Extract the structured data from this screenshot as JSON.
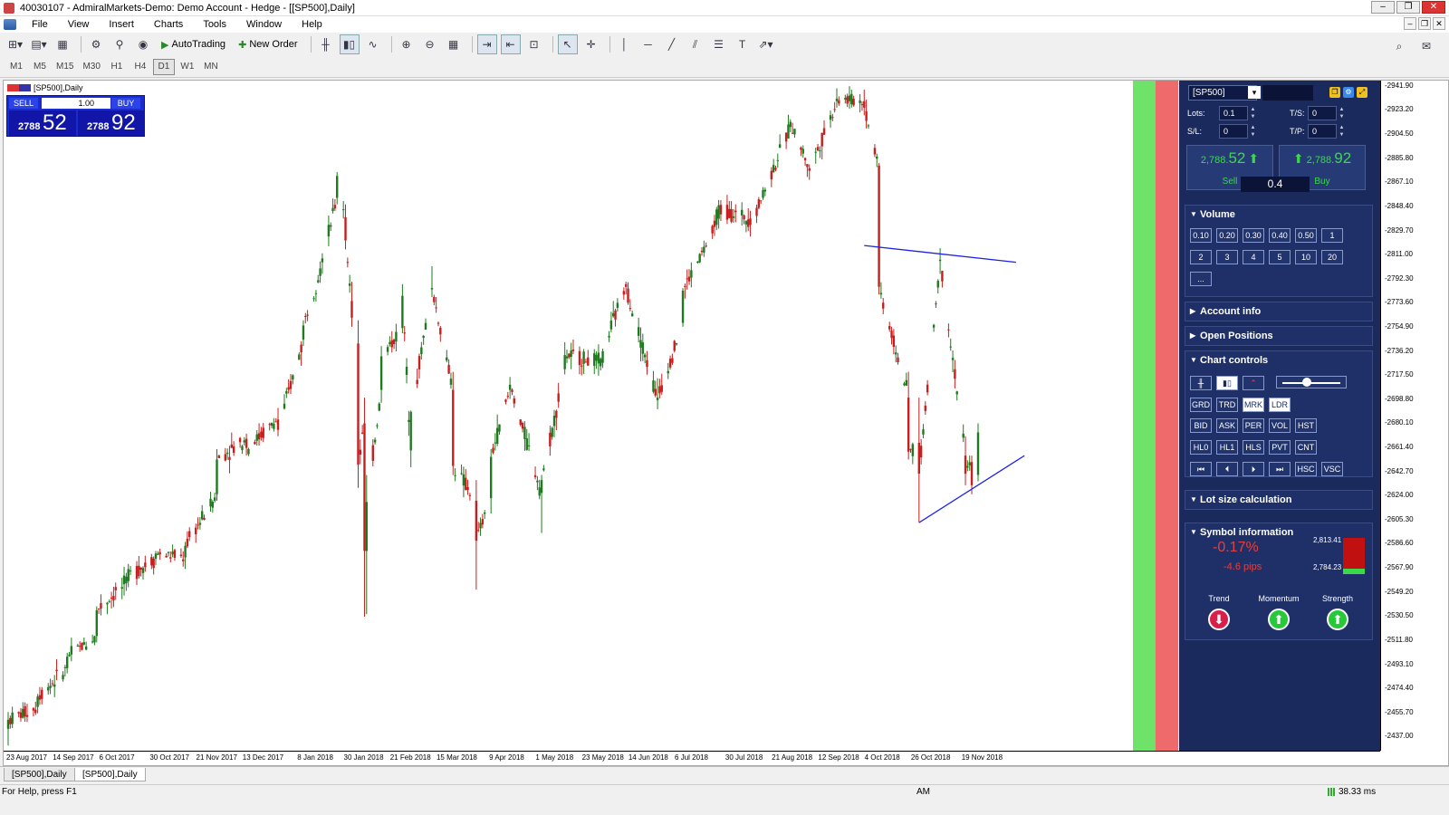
{
  "window": {
    "title": "40030107 - AdmiralMarkets-Demo: Demo Account - Hedge - [[SP500],Daily]",
    "buttons": [
      "–",
      "❐",
      "✕"
    ]
  },
  "menu": [
    "File",
    "View",
    "Insert",
    "Charts",
    "Tools",
    "Window",
    "Help"
  ],
  "toolbar": {
    "autotrading": "AutoTrading",
    "neworder": "New Order"
  },
  "timeframes": [
    "M1",
    "M5",
    "M15",
    "M30",
    "H1",
    "H4",
    "D1",
    "W1",
    "MN"
  ],
  "active_timeframe": "D1",
  "chart": {
    "title": "[SP500],Daily",
    "oneclick": {
      "sell_label": "SELL",
      "buy_label": "BUY",
      "lot": "1.00",
      "sell_small": "2788",
      "sell_big": "52",
      "buy_small": "2788",
      "buy_big": "92"
    },
    "x_ticks": [
      "23 Aug 2017",
      "14 Sep 2017",
      "6 Oct 2017",
      "30 Oct 2017",
      "21 Nov 2017",
      "13 Dec 2017",
      "8 Jan 2018",
      "30 Jan 2018",
      "21 Feb 2018",
      "15 Mar 2018",
      "9 Apr 2018",
      "1 May 2018",
      "23 May 2018",
      "14 Jun 2018",
      "6 Jul 2018",
      "30 Jul 2018",
      "21 Aug 2018",
      "12 Sep 2018",
      "4 Oct 2018",
      "26 Oct 2018",
      "19 Nov 2018"
    ],
    "y_ticks": [
      "2941.90",
      "2923.20",
      "2904.50",
      "2885.80",
      "2867.10",
      "2848.40",
      "2829.70",
      "2811.00",
      "2792.30",
      "2773.60",
      "2754.90",
      "2736.20",
      "2717.50",
      "2698.80",
      "2680.10",
      "2661.40",
      "2642.70",
      "2624.00",
      "2605.30",
      "2586.60",
      "2567.90",
      "2549.20",
      "2530.50",
      "2511.80",
      "2493.10",
      "2474.40",
      "2455.70",
      "2437.00"
    ],
    "colors": {
      "up": "#1f7a1f",
      "down": "#c81e1e",
      "trendline": "#1c22e6"
    }
  },
  "chart_data": {
    "type": "candlestick",
    "ylim": [
      2426.0,
      2946.0
    ],
    "grid": false,
    "x_start": "23 Aug 2017",
    "x_end": "26 Nov 2018",
    "anchors": [
      [
        "23 Aug 2017",
        2443,
        2456,
        2430,
        2450
      ],
      [
        "6 Sep 2017",
        2460,
        2470,
        2455,
        2468
      ],
      [
        "20 Sep 2017",
        2490,
        2502,
        2486,
        2499
      ],
      [
        "4 Oct 2017",
        2515,
        2538,
        2510,
        2535
      ],
      [
        "18 Oct 2017",
        2556,
        2564,
        2550,
        2561
      ],
      [
        "1 Nov 2017",
        2575,
        2581,
        2570,
        2579
      ],
      [
        "15 Nov 2017",
        2576,
        2588,
        2567,
        2585
      ],
      [
        "30 Nov 2017",
        2625,
        2660,
        2620,
        2652
      ],
      [
        "14 Dec 2017",
        2668,
        2672,
        2655,
        2661
      ],
      [
        "29 Dec 2017",
        2683,
        2692,
        2670,
        2675
      ],
      [
        "10 Jan 2018",
        2745,
        2760,
        2740,
        2756
      ],
      [
        "19 Jan 2018",
        2805,
        2812,
        2796,
        2808
      ],
      [
        "26 Jan 2018",
        2855,
        2875,
        2850,
        2872
      ],
      [
        "30 Jan 2018",
        2840,
        2850,
        2815,
        2822
      ],
      [
        "2 Feb 2018",
        2775,
        2790,
        2755,
        2762
      ],
      [
        "5 Feb 2018",
        2742,
        2760,
        2630,
        2648
      ],
      [
        "8 Feb 2018",
        2680,
        2700,
        2530,
        2581
      ],
      [
        "9 Feb 2018",
        2581,
        2640,
        2532,
        2619
      ],
      [
        "16 Feb 2018",
        2706,
        2740,
        2696,
        2732
      ],
      [
        "26 Feb 2018",
        2754,
        2788,
        2750,
        2779
      ],
      [
        "2 Mar 2018",
        2659,
        2690,
        2646,
        2689
      ],
      [
        "12 Mar 2018",
        2784,
        2802,
        2778,
        2785
      ],
      [
        "22 Mar 2018",
        2706,
        2720,
        2640,
        2647
      ],
      [
        "2 Apr 2018",
        2620,
        2636,
        2551,
        2589
      ],
      [
        "9 Apr 2018",
        2622,
        2660,
        2610,
        2654
      ],
      [
        "18 Apr 2018",
        2706,
        2716,
        2699,
        2710
      ],
      [
        "3 May 2018",
        2626,
        2640,
        2595,
        2636
      ],
      [
        "14 May 2018",
        2722,
        2743,
        2718,
        2733
      ],
      [
        "1 Jun 2018",
        2727,
        2738,
        2723,
        2736
      ],
      [
        "12 Jun 2018",
        2788,
        2790,
        2780,
        2786
      ],
      [
        "27 Jun 2018",
        2698,
        2715,
        2691,
        2700
      ],
      [
        "9 Jul 2018",
        2758,
        2785,
        2755,
        2783
      ],
      [
        "25 Jul 2018",
        2834,
        2848,
        2830,
        2846
      ],
      [
        "10 Aug 2018",
        2839,
        2845,
        2825,
        2834
      ],
      [
        "29 Aug 2018",
        2910,
        2916,
        2906,
        2914
      ],
      [
        "7 Sep 2018",
        2878,
        2881,
        2869,
        2876
      ],
      [
        "20 Sep 2018",
        2930,
        2940,
        2925,
        2932
      ],
      [
        "3 Oct 2018",
        2930,
        2939,
        2919,
        2925
      ],
      [
        "10 Oct 2018",
        2880,
        2882,
        2780,
        2786
      ],
      [
        "24 Oct 2018",
        2700,
        2720,
        2652,
        2658
      ],
      [
        "29 Oct 2018",
        2665,
        2700,
        2603,
        2641
      ],
      [
        "8 Nov 2018",
        2806,
        2816,
        2796,
        2807
      ],
      [
        "20 Nov 2018",
        2655,
        2670,
        2632,
        2641
      ],
      [
        "23 Nov 2018",
        2650,
        2655,
        2625,
        2632
      ],
      [
        "26 Nov 2018",
        2640,
        2680,
        2635,
        2673
      ]
    ],
    "lines": [
      {
        "from": [
          "3 Oct 2018",
          2818
        ],
        "to": [
          "14 Dec 2018",
          2805
        ],
        "color": "#1c22e6"
      },
      {
        "from": [
          "29 Oct 2018",
          2603
        ],
        "to": [
          "18 Dec 2018",
          2655
        ],
        "color": "#1c22e6"
      }
    ]
  },
  "panel": {
    "symbol": "[SP500]",
    "lots_label": "Lots:",
    "lots": "0.1",
    "ts_label": "T/S:",
    "ts": "0",
    "sl_label": "S/L:",
    "sl": "0",
    "tp_label": "T/P:",
    "tp": "0",
    "sell_small": "2,788.",
    "sell_big": "52",
    "buy_small": "2,788.",
    "buy_big": "92",
    "sell_label": "Sell",
    "buy_label": "Buy",
    "spread": "0.4",
    "volume_title": "Volume",
    "volume_btns": [
      "0.10",
      "0.20",
      "0.30",
      "0.40",
      "0.50",
      "1",
      "2",
      "3",
      "4",
      "5",
      "10",
      "20",
      "..."
    ],
    "account_title": "Account info",
    "positions_title": "Open Positions",
    "controls_title": "Chart controls",
    "controls_row1": [
      "GRD",
      "TRD",
      "MRK",
      "LDR"
    ],
    "controls_row2": [
      "BID",
      "ASK",
      "PER",
      "VOL",
      "HST"
    ],
    "controls_row3": [
      "HL0",
      "HL1",
      "HLS",
      "PVT",
      "CNT"
    ],
    "controls_row4": [
      "⏮",
      "⏴",
      "⏵",
      "⏭",
      "HSC",
      "VSC"
    ],
    "lotsize_title": "Lot size calculation",
    "syminfo_title": "Symbol information",
    "pct": "-0.17%",
    "pips": "-4.6 pips",
    "high": "2,813.41",
    "low": "2,784.23",
    "trend": "Trend",
    "momentum": "Momentum",
    "strength": "Strength"
  },
  "tabs": [
    "[SP500],Daily",
    "[SP500],Daily"
  ],
  "status": {
    "help": "For Help, press F1",
    "mode": "AM",
    "ping": "38.33 ms"
  }
}
